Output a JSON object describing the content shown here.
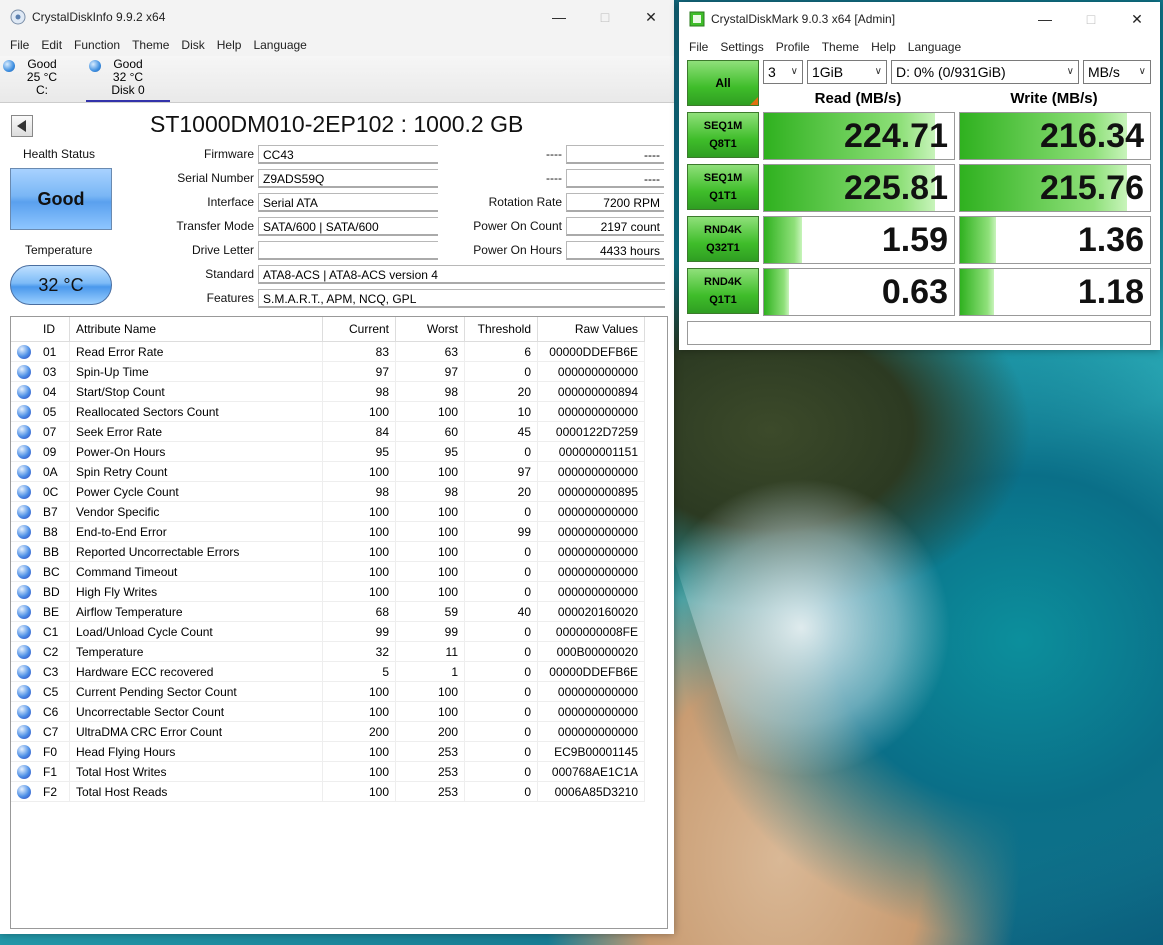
{
  "cdi": {
    "title": "CrystalDiskInfo 9.9.2 x64",
    "menu": [
      "File",
      "Edit",
      "Function",
      "Theme",
      "Disk",
      "Help",
      "Language"
    ],
    "disks": [
      {
        "status": "Good",
        "temp": "25 °C",
        "name": "C:"
      },
      {
        "status": "Good",
        "temp": "32 °C",
        "name": "Disk 0"
      }
    ],
    "disk_title": "ST1000DM010-2EP102 : 1000.2 GB",
    "labels": {
      "health_status": "Health Status",
      "temperature": "Temperature",
      "firmware": "Firmware",
      "serial": "Serial Number",
      "interface": "Interface",
      "transfer": "Transfer Mode",
      "drive_letter": "Drive Letter",
      "standard": "Standard",
      "features": "Features",
      "dash1": "----",
      "dash2": "----",
      "rotation": "Rotation Rate",
      "power_count": "Power On Count",
      "power_hours": "Power On Hours"
    },
    "values": {
      "health": "Good",
      "temp": "32 °C",
      "firmware": "CC43",
      "serial": "Z9ADS59Q",
      "interface": "Serial ATA",
      "transfer": "SATA/600 | SATA/600",
      "drive_letter": "",
      "standard": "ATA8-ACS | ATA8-ACS version 4",
      "features": "S.M.A.R.T., APM, NCQ, GPL",
      "dash1": "----",
      "dash2": "----",
      "rotation": "7200 RPM",
      "power_count": "2197 count",
      "power_hours": "4433 hours"
    },
    "smart_headers": [
      "ID",
      "Attribute Name",
      "Current",
      "Worst",
      "Threshold",
      "Raw Values"
    ],
    "smart_rows": [
      [
        "01",
        "Read Error Rate",
        "83",
        "63",
        "6",
        "00000DDEFB6E"
      ],
      [
        "03",
        "Spin-Up Time",
        "97",
        "97",
        "0",
        "000000000000"
      ],
      [
        "04",
        "Start/Stop Count",
        "98",
        "98",
        "20",
        "000000000894"
      ],
      [
        "05",
        "Reallocated Sectors Count",
        "100",
        "100",
        "10",
        "000000000000"
      ],
      [
        "07",
        "Seek Error Rate",
        "84",
        "60",
        "45",
        "0000122D7259"
      ],
      [
        "09",
        "Power-On Hours",
        "95",
        "95",
        "0",
        "000000001151"
      ],
      [
        "0A",
        "Spin Retry Count",
        "100",
        "100",
        "97",
        "000000000000"
      ],
      [
        "0C",
        "Power Cycle Count",
        "98",
        "98",
        "20",
        "000000000895"
      ],
      [
        "B7",
        "Vendor Specific",
        "100",
        "100",
        "0",
        "000000000000"
      ],
      [
        "B8",
        "End-to-End Error",
        "100",
        "100",
        "99",
        "000000000000"
      ],
      [
        "BB",
        "Reported Uncorrectable Errors",
        "100",
        "100",
        "0",
        "000000000000"
      ],
      [
        "BC",
        "Command Timeout",
        "100",
        "100",
        "0",
        "000000000000"
      ],
      [
        "BD",
        "High Fly Writes",
        "100",
        "100",
        "0",
        "000000000000"
      ],
      [
        "BE",
        "Airflow Temperature",
        "68",
        "59",
        "40",
        "000020160020"
      ],
      [
        "C1",
        "Load/Unload Cycle Count",
        "99",
        "99",
        "0",
        "0000000008FE"
      ],
      [
        "C2",
        "Temperature",
        "32",
        "11",
        "0",
        "000B00000020"
      ],
      [
        "C3",
        "Hardware ECC recovered",
        "5",
        "1",
        "0",
        "00000DDEFB6E"
      ],
      [
        "C5",
        "Current Pending Sector Count",
        "100",
        "100",
        "0",
        "000000000000"
      ],
      [
        "C6",
        "Uncorrectable Sector Count",
        "100",
        "100",
        "0",
        "000000000000"
      ],
      [
        "C7",
        "UltraDMA CRC Error Count",
        "200",
        "200",
        "0",
        "000000000000"
      ],
      [
        "F0",
        "Head Flying Hours",
        "100",
        "253",
        "0",
        "EC9B00001145"
      ],
      [
        "F1",
        "Total Host Writes",
        "100",
        "253",
        "0",
        "000768AE1C1A"
      ],
      [
        "F2",
        "Total Host Reads",
        "100",
        "253",
        "0",
        "0006A85D3210"
      ]
    ]
  },
  "cdm": {
    "title": "CrystalDiskMark 9.0.3 x64 [Admin]",
    "menu": [
      "File",
      "Settings",
      "Profile",
      "Theme",
      "Help",
      "Language"
    ],
    "all_label": "All",
    "count": "3",
    "size": "1GiB",
    "drive": "D: 0% (0/931GiB)",
    "unit": "MB/s",
    "read_header": "Read (MB/s)",
    "write_header": "Write (MB/s)",
    "tests": [
      {
        "l1": "SEQ1M",
        "l2": "Q8T1",
        "read": "224.71",
        "write": "216.34",
        "read_fill": 0.9,
        "write_fill": 0.88
      },
      {
        "l1": "SEQ1M",
        "l2": "Q1T1",
        "read": "225.81",
        "write": "215.76",
        "read_fill": 0.9,
        "write_fill": 0.88
      },
      {
        "l1": "RND4K",
        "l2": "Q32T1",
        "read": "1.59",
        "write": "1.36",
        "read_fill": 0.2,
        "write_fill": 0.19
      },
      {
        "l1": "RND4K",
        "l2": "Q1T1",
        "read": "0.63",
        "write": "1.18",
        "read_fill": 0.13,
        "write_fill": 0.18
      }
    ],
    "comment": ""
  }
}
